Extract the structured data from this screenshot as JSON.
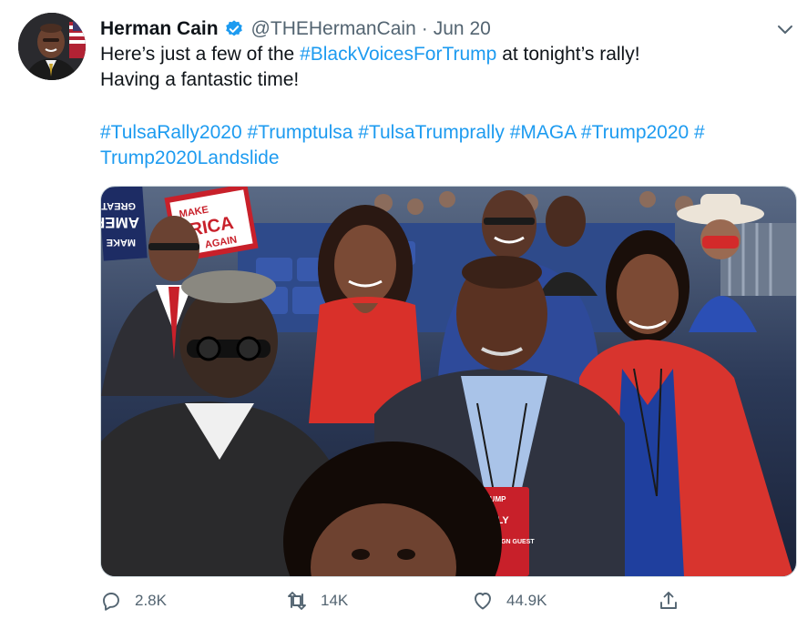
{
  "tweet": {
    "author_name": "Herman Cain",
    "handle": "@THEHermanCain",
    "separator": "·",
    "date": "Jun 20",
    "text": {
      "line1_pre": "Here’s just a few of the ",
      "line1_tag": "#BlackVoicesForTrump",
      "line1_post": " at tonight’s rally!",
      "line2": "Having a fantastic time!"
    },
    "hashtags": {
      "line1": "#TulsaRally2020 #Trumptulsa #TulsaTrumprally #MAGA #Trump2020 #",
      "line2": "Trump2020Landslide"
    },
    "photo": {
      "signs": {
        "sign1_a": "GREAT",
        "sign1_b": "AMERI",
        "sign1_c": "MAKE",
        "sign2_a": "MAKE",
        "sign2_b": "RICA",
        "sign2_c": "AGAIN"
      },
      "badge": {
        "top": "TRUMP",
        "middle": "RALLY",
        "bottom": "CAMPAIGN GUEST"
      }
    },
    "actions": {
      "reply_count": "2.8K",
      "retweet_count": "14K",
      "like_count": "44.9K"
    },
    "colors": {
      "link": "#1d9bf0",
      "muted": "#536471",
      "verified": "#1d9bf0"
    }
  }
}
